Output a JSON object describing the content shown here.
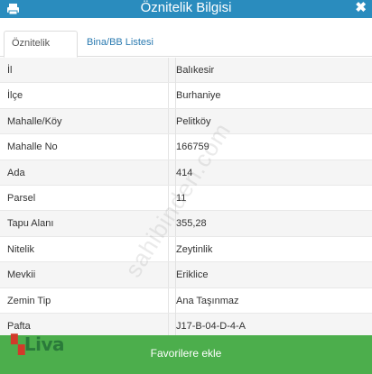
{
  "header": {
    "title": "Öznitelik Bilgisi",
    "close_label": "✖"
  },
  "tabs": [
    {
      "label": "Öznitelik Bilgisi"
    },
    {
      "label": "Bina/BB Listesi"
    }
  ],
  "rows": [
    {
      "key": "İl",
      "value": "Balıkesir"
    },
    {
      "key": "İlçe",
      "value": "Burhaniye"
    },
    {
      "key": "Mahalle/Köy",
      "value": "Pelitköy"
    },
    {
      "key": "Mahalle No",
      "value": "166759"
    },
    {
      "key": "Ada",
      "value": "414"
    },
    {
      "key": "Parsel",
      "value": "11"
    },
    {
      "key": "Tapu Alanı",
      "value": "355,28"
    },
    {
      "key": "Nitelik",
      "value": "Zeytinlik"
    },
    {
      "key": "Mevkii",
      "value": "Eriklice"
    },
    {
      "key": "Zemin Tip",
      "value": "Ana Taşınmaz"
    },
    {
      "key": "Pafta",
      "value": "J17-B-04-D-4-A"
    }
  ],
  "watermark": "sahibinden.com",
  "logo": {
    "text": "Liva"
  },
  "favorite_button": "Favorilere ekle",
  "colors": {
    "header": "#2a8cbe",
    "button": "#4cae4c",
    "tab_link": "#2a7ab0"
  }
}
